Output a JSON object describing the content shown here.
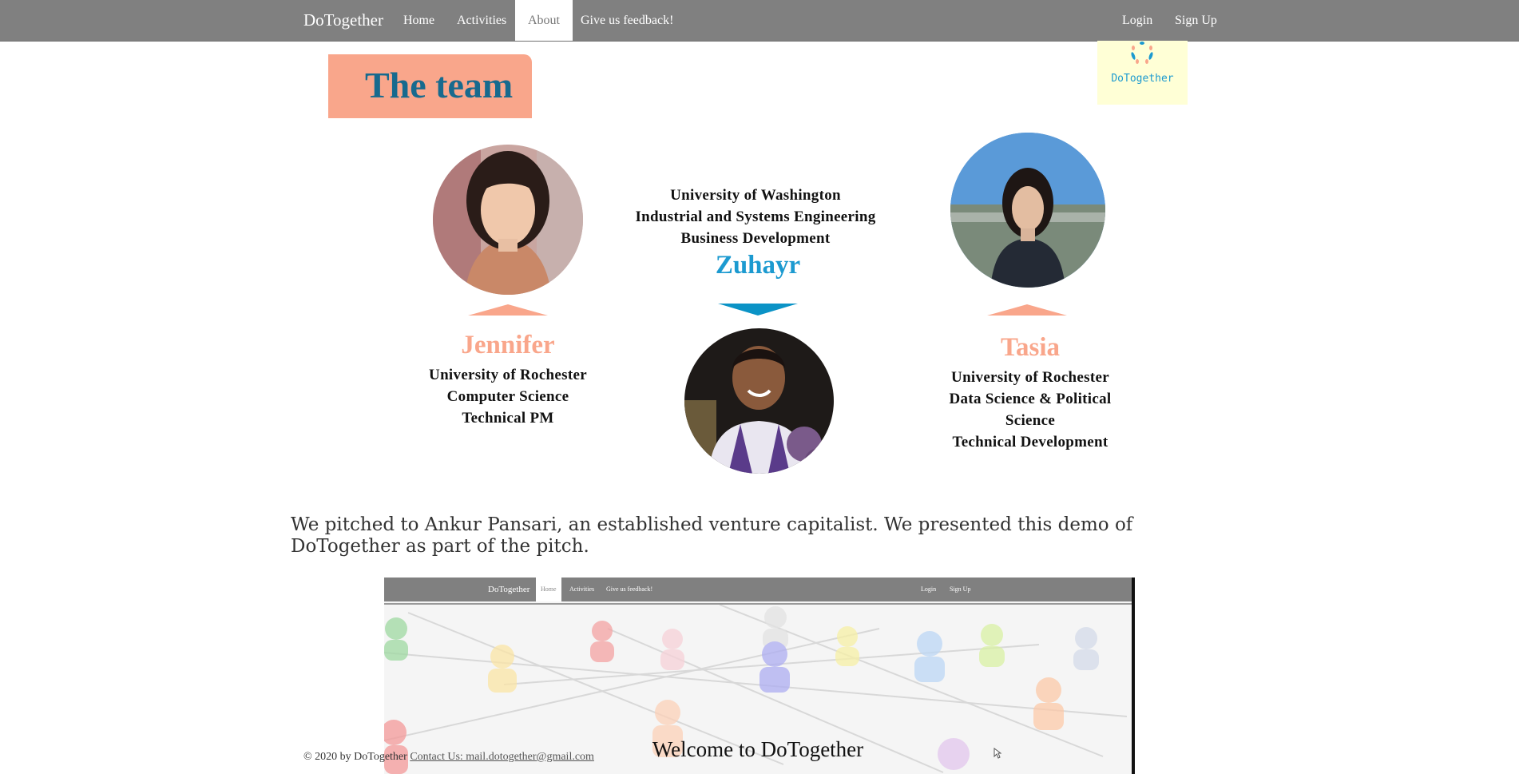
{
  "navbar": {
    "brand": "DoTogether",
    "links": [
      {
        "label": "Home"
      },
      {
        "label": "Activities"
      },
      {
        "label": "About"
      },
      {
        "label": "Give us feedback!"
      }
    ],
    "login": "Login",
    "signup": "Sign Up"
  },
  "logo": {
    "text": "DoTogether"
  },
  "team_title": "The team",
  "members": [
    {
      "name": "Jennifer",
      "school": "University of Rochester",
      "major": "Computer Science",
      "role": "Technical PM"
    },
    {
      "name": "Zuhayr",
      "school": "University of Washington",
      "major": "Industrial and Systems Engineering",
      "role": "Business Development"
    },
    {
      "name": "Tasia",
      "school": "University of Rochester",
      "major_line1": "Data Science & Political",
      "major_line2": "Science",
      "role": "Technical Development"
    }
  ],
  "pitch_text": "We pitched to Ankur Pansari, an established venture capitalist. We presented this demo of DoTogether as part of the pitch.",
  "demo": {
    "brand": "DoTogether",
    "home": "Home",
    "activities": "Activities",
    "feedback": "Give us feedback!",
    "login": "Login",
    "signup": "Sign Up",
    "welcome": "Welcome to DoTogether"
  },
  "footer": {
    "copyright": "© 2020 by DoTogether",
    "contact": "Contact Us: mail.dotogether@gmail.com"
  },
  "colors": {
    "navbar_bg": "#808080",
    "peach": "#f9a68b",
    "title_blue": "#176a8e",
    "name_blue": "#1c9ad0",
    "logo_bg": "#ffffd6"
  }
}
